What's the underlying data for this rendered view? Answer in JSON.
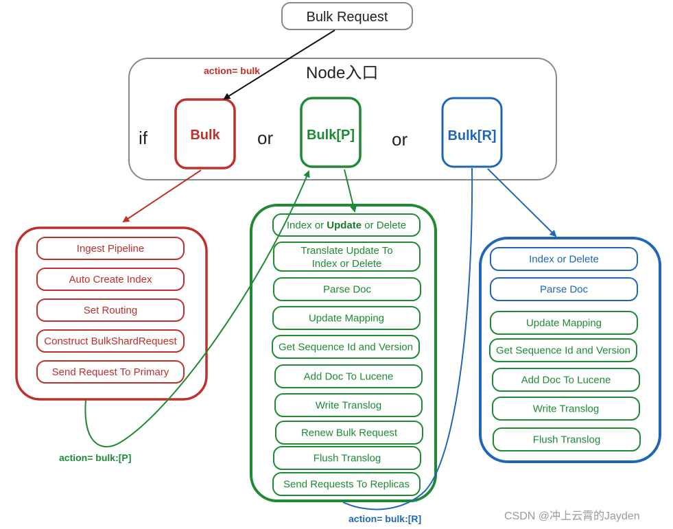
{
  "colors": {
    "red": "#c0302a",
    "green": "#1e8a34",
    "blue": "#1f65b8",
    "gray": "#888888",
    "black": "#111111",
    "watermark": "#9a9a9a"
  },
  "request": {
    "label": "Bulk Request"
  },
  "node_entry": {
    "title": "Node入口",
    "if_label": "if",
    "or_label_1": "or",
    "or_label_2": "or",
    "handlers": [
      {
        "id": "bulk",
        "label": "Bulk",
        "color": "red"
      },
      {
        "id": "bulk-p",
        "label": "Bulk[P]",
        "color": "green"
      },
      {
        "id": "bulk-r",
        "label": "Bulk[R]",
        "color": "blue"
      }
    ]
  },
  "edge_labels": {
    "action_bulk": "action= bulk",
    "action_bulk_p": "action= bulk:[P]",
    "action_bulk_r": "action= bulk:[R]"
  },
  "bulk_steps": [
    "Ingest Pipeline",
    "Auto Create Index",
    "Set Routing",
    "Construct BulkShardRequest",
    "Send Request  To Primary"
  ],
  "primary_steps": {
    "first": {
      "pre": "Index or ",
      "bold": "Update",
      "post": " or Delete"
    },
    "translate_line1": "Translate Update To",
    "translate_line2": "Index or Delete",
    "rest": [
      "Parse Doc",
      "Update Mapping",
      "Get Sequence Id and Version",
      "Add Doc To Lucene",
      "Write Translog",
      "Renew Bulk Request",
      "Flush Translog",
      "Send Requests To Replicas"
    ]
  },
  "replica_steps": [
    {
      "label": "Index or Delete",
      "color": "blue"
    },
    {
      "label": "Parse Doc",
      "color": "blue"
    },
    {
      "label": "Update Mapping",
      "color": "green"
    },
    {
      "label": "Get Sequence Id and Version",
      "color": "green"
    },
    {
      "label": "Add Doc To Lucene",
      "color": "green"
    },
    {
      "label": "Write Translog",
      "color": "green"
    },
    {
      "label": "Flush Translog",
      "color": "green"
    }
  ],
  "watermark": "CSDN @冲上云霄的Jayden"
}
